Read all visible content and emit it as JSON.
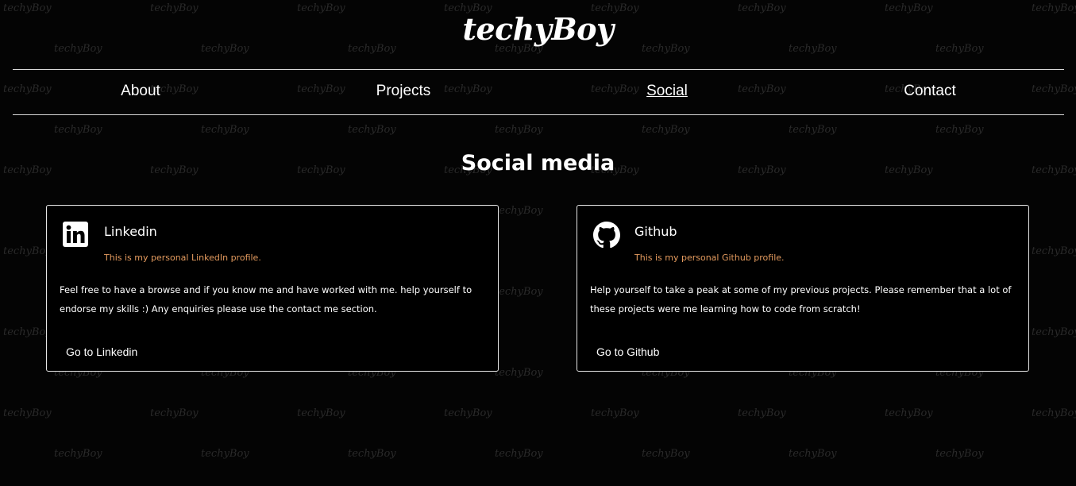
{
  "brand": {
    "logo_text": "techyBoy",
    "watermark_text": "techyBoy"
  },
  "nav": {
    "items": [
      {
        "label": "About"
      },
      {
        "label": "Projects"
      },
      {
        "label": "Social",
        "active": true
      },
      {
        "label": "Contact"
      }
    ]
  },
  "section": {
    "title": "Social media"
  },
  "cards": [
    {
      "icon": "linkedin-icon",
      "title": "Linkedin",
      "subtitle": "This is my personal LinkedIn profile.",
      "body": "Feel free to have a browse and if you know me and have worked with me. help yourself to endorse my skills :) Any enquiries please use the contact me section.",
      "link_label": "Go to Linkedin"
    },
    {
      "icon": "github-icon",
      "title": "Github",
      "subtitle": "This is my personal Github profile.",
      "body": "Help yourself to take a peak at some of my previous projects. Please remember that a lot of these projects were me learning how to code from scratch!",
      "link_label": "Go to Github"
    }
  ],
  "colors": {
    "background": "#040404",
    "text": "#ffffff",
    "accent_subtitle": "#e39a5e",
    "border": "#e6e6e6"
  }
}
